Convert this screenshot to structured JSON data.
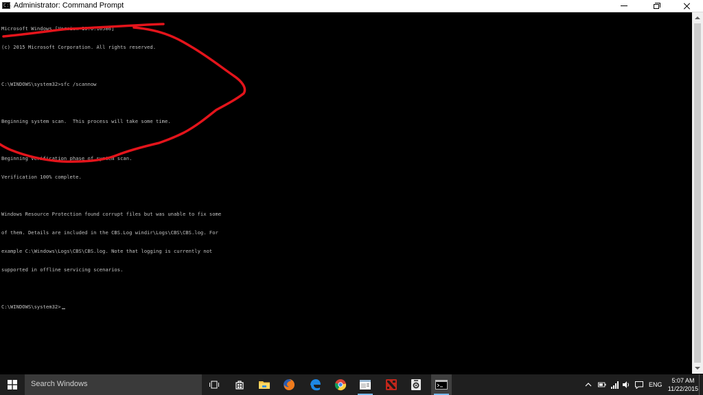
{
  "window": {
    "title": "Administrator: Command Prompt",
    "app_icon_text": "C:\\"
  },
  "console": {
    "lines": [
      "Microsoft Windows [Version 10.0.10586]",
      "(c) 2015 Microsoft Corporation. All rights reserved.",
      "",
      "C:\\WINDOWS\\system32>sfc /scannow",
      "",
      "Beginning system scan.  This process will take some time.",
      "",
      "Beginning verification phase of system scan.",
      "Verification 100% complete.",
      "",
      "Windows Resource Protection found corrupt files but was unable to fix some",
      "of them. Details are included in the CBS.Log windir\\Logs\\CBS\\CBS.log. For",
      "example C:\\Windows\\Logs\\CBS\\CBS.log. Note that logging is currently not",
      "supported in offline servicing scenarios.",
      "",
      "C:\\WINDOWS\\system32>"
    ],
    "text_color": "#c0c0c0",
    "background": "#000000"
  },
  "annotation": {
    "color": "#e3141b"
  },
  "taskbar": {
    "search_placeholder": "Search Windows",
    "pinned": [
      {
        "name": "task-view",
        "icon": "task-view-icon"
      },
      {
        "name": "store",
        "icon": "store-icon"
      },
      {
        "name": "file-explorer",
        "icon": "folder-icon"
      },
      {
        "name": "firefox",
        "icon": "firefox-icon"
      },
      {
        "name": "edge",
        "icon": "edge-icon"
      },
      {
        "name": "chrome",
        "icon": "chrome-icon"
      },
      {
        "name": "app-window",
        "icon": "window-app-icon"
      },
      {
        "name": "dota2",
        "icon": "dota2-icon"
      },
      {
        "name": "camera-app",
        "icon": "camera-icon"
      },
      {
        "name": "command-prompt",
        "icon": "cmd-icon"
      }
    ],
    "tray": {
      "language": "ENG",
      "time": "5:07 AM",
      "date": "11/22/2015"
    }
  }
}
